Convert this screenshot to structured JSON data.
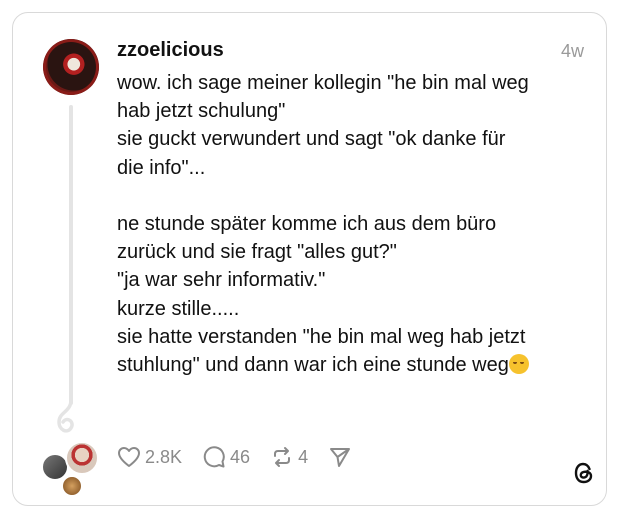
{
  "post": {
    "username": "zzoelicious",
    "time": "4w",
    "lines": [
      "wow. ich sage meiner kollegin \"he bin mal weg",
      "hab jetzt schulung\"",
      "sie guckt verwundert und sagt \"ok danke für",
      "die info\"...",
      "",
      "ne stunde später komme ich aus dem büro",
      "zurück und sie fragt \"alles gut?\"",
      "\"ja war sehr informativ.\"",
      "kurze stille.....",
      "sie hatte verstanden \"he bin mal weg hab jetzt",
      "stuhlung\" und dann war ich eine stunde weg"
    ]
  },
  "actions": {
    "likes": "2.8K",
    "replies": "46",
    "reposts": "4"
  },
  "icons": {
    "like": "heart-icon",
    "reply": "comment-icon",
    "repost": "repost-icon",
    "share": "send-icon",
    "brand": "threads-logo-icon",
    "emoji": "relieved-face-emoji"
  }
}
